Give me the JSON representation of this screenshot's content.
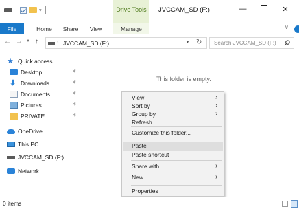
{
  "window": {
    "title": "JVCCAM_SD (F:)",
    "contextual_group": "Drive Tools",
    "minimize_glyph": "—",
    "close_glyph": "✕"
  },
  "ribbon": {
    "tabs": [
      "File",
      "Home",
      "Share",
      "View",
      "Manage"
    ]
  },
  "address": {
    "path": "JVCCAM_SD (F:)",
    "search_placeholder": "Search JVCCAM_SD (F:)"
  },
  "nav_pane": {
    "items": [
      {
        "label": "Quick access",
        "icon": "star-icon"
      },
      {
        "label": "Desktop",
        "icon": "desktop-icon",
        "pinned": true
      },
      {
        "label": "Downloads",
        "icon": "download-icon",
        "pinned": true
      },
      {
        "label": "Documents",
        "icon": "documents-icon",
        "pinned": true
      },
      {
        "label": "Pictures",
        "icon": "pictures-icon",
        "pinned": true
      },
      {
        "label": "PRIVATE",
        "icon": "folder-icon",
        "pinned": true
      },
      {
        "label": "OneDrive",
        "icon": "cloud-icon"
      },
      {
        "label": "This PC",
        "icon": "computer-icon"
      },
      {
        "label": "JVCCAM_SD (F:)",
        "icon": "drive-icon",
        "selected": true
      },
      {
        "label": "Network",
        "icon": "network-icon"
      }
    ]
  },
  "content": {
    "empty_message": "This folder is empty."
  },
  "context_menu": {
    "items": [
      {
        "label": "View",
        "submenu": true
      },
      {
        "label": "Sort by",
        "submenu": true
      },
      {
        "label": "Group by",
        "submenu": true
      },
      {
        "label": "Refresh"
      },
      {
        "label": "Customize this folder..."
      },
      {
        "label": "Paste",
        "highlighted": true
      },
      {
        "label": "Paste shortcut"
      },
      {
        "label": "Share with",
        "submenu": true
      },
      {
        "label": "New",
        "submenu": true
      },
      {
        "label": "Properties"
      }
    ]
  },
  "status_bar": {
    "item_count": "0 items"
  },
  "colors": {
    "accent": "#1979ca",
    "drive_tools": "#4f7a1c",
    "menu_bg": "#f2f2f2",
    "menu_highlight": "#dedede"
  }
}
